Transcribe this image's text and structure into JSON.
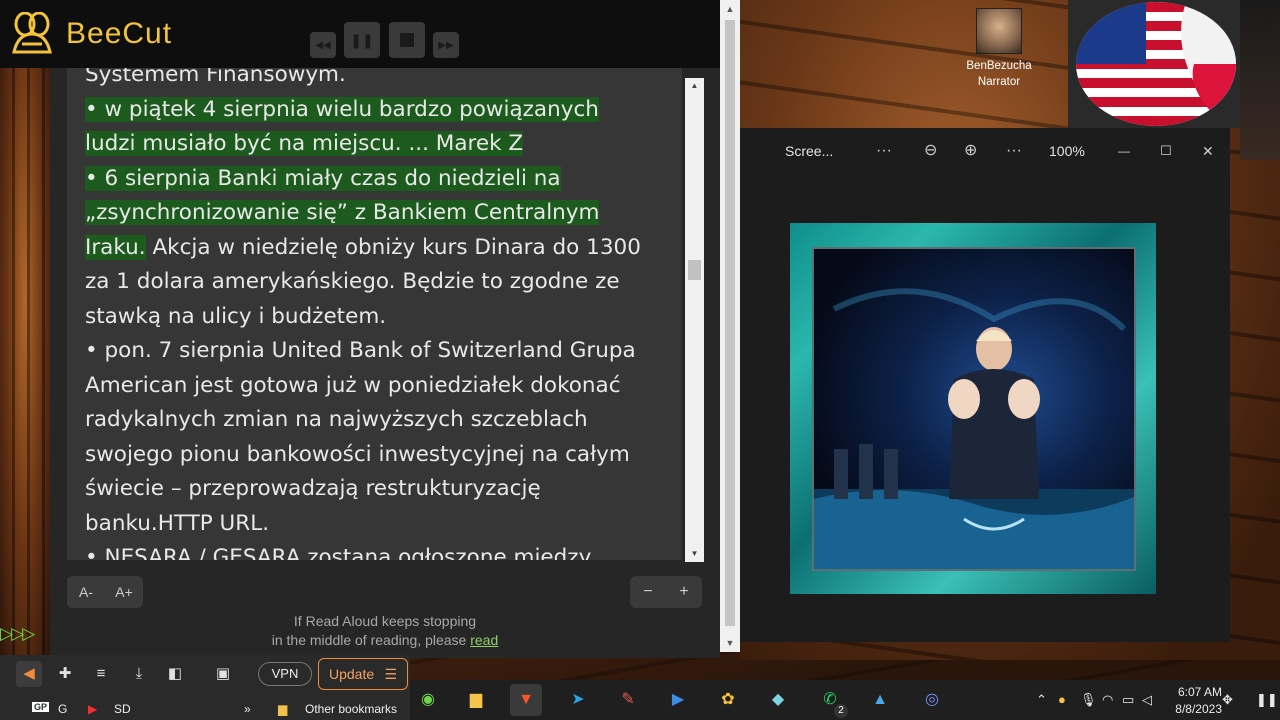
{
  "beecut": {
    "app_name": "BeeCut",
    "controls": [
      "rewind-icon",
      "pause-icon",
      "stop-icon",
      "forward-icon"
    ]
  },
  "reader": {
    "paragraph_0_tail": "Systemem Finansowym.",
    "lines": [
      {
        "text": "• w piątek 4 sierpnia wielu bardzo powiązanych",
        "highlight": true
      },
      {
        "text": "ludzi musiało być na miejscu. ... Marek Z",
        "highlight": true
      },
      {
        "text": "• 6 sierpnia Banki miały czas do niedzieli na",
        "highlight": true
      },
      {
        "text": "„zsynchronizowanie się” z Bankiem Centralnym",
        "highlight": true
      },
      {
        "text": "Iraku.",
        "highlight": true,
        "rest": " Akcja w niedzielę obniży kurs Dinara do 1300"
      },
      {
        "text": "za 1 dolara amerykańskiego. Będzie to zgodne ze",
        "highlight": false
      },
      {
        "text": "stawką na ulicy i budżetem.",
        "highlight": false
      },
      {
        "text": "• pon. 7 sierpnia United Bank of Switzerland Grupa",
        "highlight": false
      },
      {
        "text": "American jest gotowa już w poniedziałek dokonać",
        "highlight": false
      },
      {
        "text": "radykalnych zmian na najwyższych szczeblach",
        "highlight": false
      },
      {
        "text": "swojego pionu bankowości inwestycyjnej na całym",
        "highlight": false
      },
      {
        "text": "świecie – przeprowadzają restrukturyzację",
        "highlight": false
      },
      {
        "text": "banku.HTTP URL.",
        "highlight": false
      },
      {
        "text": "• NESARA / GESARA zostana ogłoszone miedzy",
        "highlight": false
      }
    ],
    "font_smaller": "A-",
    "font_larger": "A+",
    "speed_minus": "−",
    "speed_plus": "+",
    "note_line1": "If Read Aloud keeps stopping",
    "note_line2": "in the middle of reading, please",
    "note_link": "read"
  },
  "narrator": {
    "name": "BenBezucha",
    "role": "Narrator"
  },
  "viewer": {
    "title": "Scree...",
    "zoom": "100%",
    "more_label": "···"
  },
  "browser": {
    "vpn": "VPN",
    "update": "Update",
    "bookmarks": {
      "item_g": "G",
      "item_sd": "SD",
      "other": "Other bookmarks",
      "more": "»"
    }
  },
  "taskbar": {
    "time": "6:07 AM",
    "date": "8/8/2023",
    "whatsapp_badge": "2"
  },
  "colors": {
    "beecut_yellow": "#f3c33b",
    "highlight_green": "#1d5a1d",
    "update_orange": "#f08b3b",
    "link_green": "#8fd16b"
  }
}
